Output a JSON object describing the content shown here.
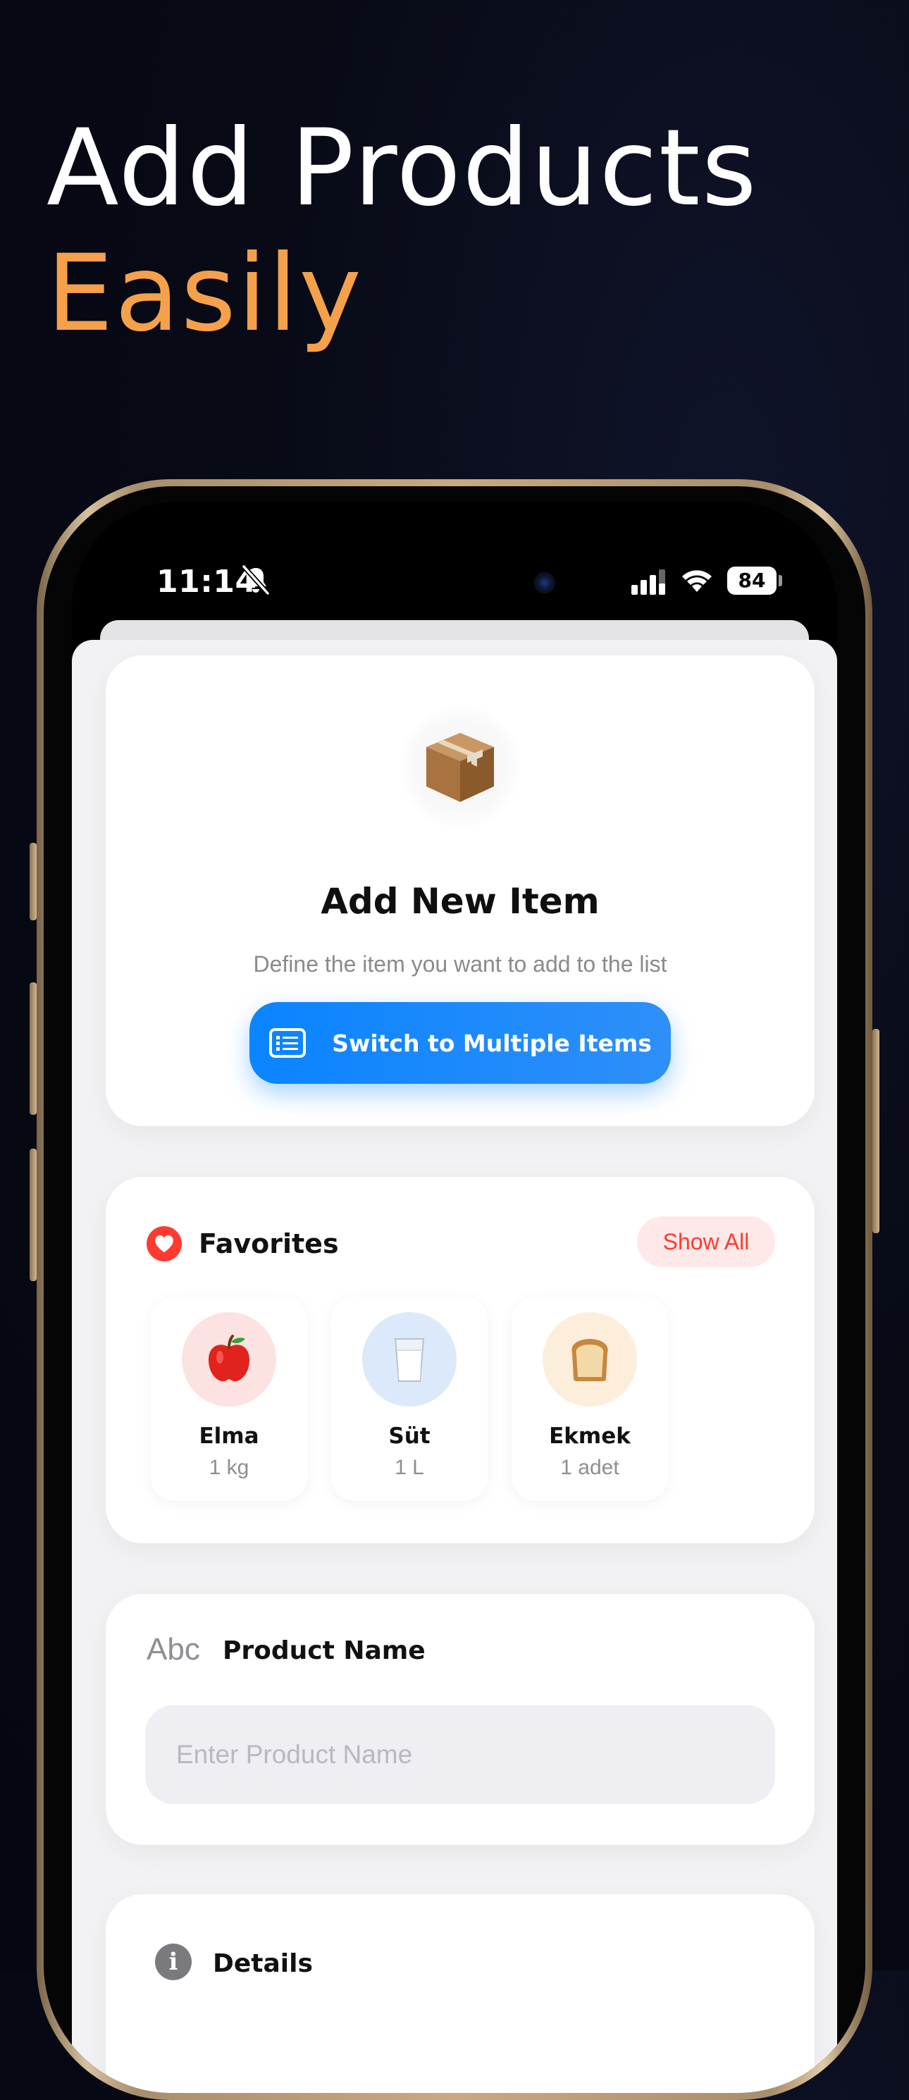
{
  "headline": {
    "line1": "Add Products",
    "line2": "Easily",
    "accent_color": "#f5a04a"
  },
  "status_bar": {
    "time": "11:14",
    "battery": "84",
    "icons": [
      "bell-slash-icon",
      "cellular-signal-icon",
      "wifi-icon",
      "battery-icon"
    ]
  },
  "add_item_card": {
    "icon": "package-box-icon",
    "title": "Add New Item",
    "subtitle": "Define the item you want to add to the list",
    "switch_button_label": "Switch to Multiple Items",
    "switch_button_color": "#0a84ff"
  },
  "favorites": {
    "title": "Favorites",
    "show_all_label": "Show All",
    "items": [
      {
        "name": "Elma",
        "qty": "1 kg",
        "emoji": "🍎",
        "bg": "#fde2e2"
      },
      {
        "name": "Süt",
        "qty": "1 L",
        "emoji": "🥛",
        "bg": "#dce9fb"
      },
      {
        "name": "Ekmek",
        "qty": "1 adet",
        "emoji": "🍞",
        "bg": "#fdeedb"
      }
    ]
  },
  "product_name": {
    "icon_text": "Abc",
    "label": "Product Name",
    "placeholder": "Enter Product Name",
    "value": ""
  },
  "details": {
    "icon": "info-icon",
    "label": "Details"
  }
}
